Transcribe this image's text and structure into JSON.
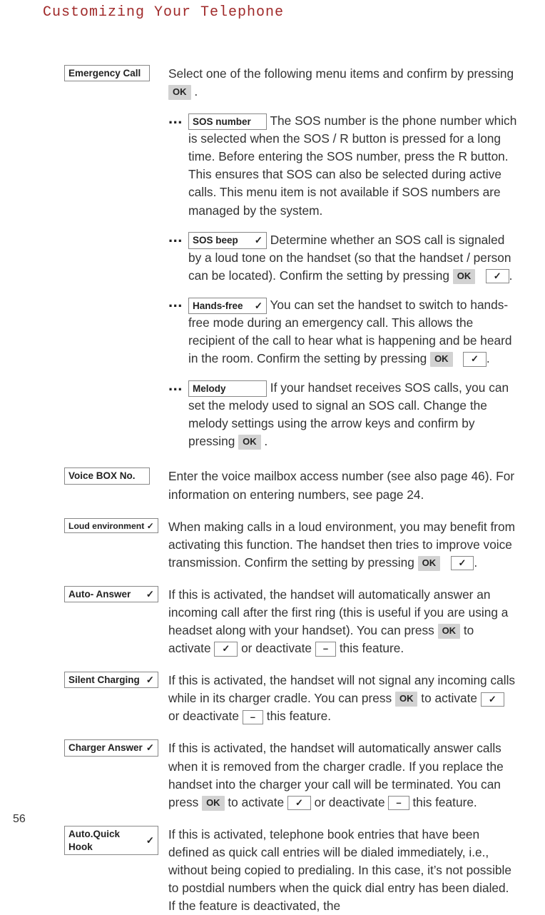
{
  "page_title": "Customizing Your Telephone",
  "page_number": "56",
  "keys": {
    "ok": "OK",
    "check": "✓",
    "minus": "–"
  },
  "ellipsis": "...",
  "sections": [
    {
      "id": "emergency",
      "label": "Emergency Call",
      "intro": "Select one of the following menu items and confirm by pressing ",
      "intro_suffix": " .",
      "subitems": [
        {
          "id": "sos_number",
          "label": "SOS number",
          "text": " The SOS number is the phone number which is selected when the SOS / R button is pressed for a long time. Before entering the SOS number, press the R button. This ensures that SOS can also be selected during active calls. This menu item is not available if SOS numbers are managed by the system."
        },
        {
          "id": "sos_beep",
          "label": "SOS beep",
          "label_check": true,
          "text_a": " Determine whether an SOS call is signaled by a loud tone on the handset (so that the handset / person can be located). Confirm the setting by pressing ",
          "text_b": "."
        },
        {
          "id": "hands_free",
          "label": "Hands-free",
          "label_check": true,
          "text_a": " You can set the handset to switch to hands-free mode during an emergency call. This allows the recipient of the call to hear what is happening and be heard in the room. Confirm the setting by pressing ",
          "text_b": "."
        },
        {
          "id": "melody",
          "label": "Melody",
          "text_a": " If your handset receives SOS calls, you can set the melody used to signal an SOS call. Change the melody settings using the arrow keys and confirm by pressing ",
          "text_b": " ."
        }
      ]
    },
    {
      "id": "voicebox",
      "label": "Voice BOX No.",
      "text": "Enter the voice mailbox access number (see also page 46). For information on entering numbers, see page 24."
    },
    {
      "id": "loud_env",
      "label": "Loud environment",
      "label_check": true,
      "text_a": "When making calls in a loud environment, you may benefit from activating this function. The handset then tries to improve voice transmission. Confirm the setting by pressing ",
      "text_b": "."
    },
    {
      "id": "auto_answer",
      "label": "Auto- Answer",
      "label_check": true,
      "text_a": "If this is activated, the handset will automatically answer an incoming call after the first ring (this is useful if you are using a headset along with your handset). You can press ",
      "text_b": " to activate ",
      "text_c": " or deactivate ",
      "text_d": " this feature."
    },
    {
      "id": "silent_charging",
      "label": "Silent Charging",
      "label_check": true,
      "text_a": "If this is activated, the handset will not signal any incoming calls while in its charger cradle. You can press ",
      "text_b": " to activate ",
      "text_c": " or deactivate ",
      "text_d": " this feature."
    },
    {
      "id": "charger_answer",
      "label": "Charger Answer",
      "label_check": true,
      "text_a": "If this is activated, the handset will automatically answer calls when it is removed from the charger cradle. If you replace the handset into the charger your call will be terminated. You can press ",
      "text_b": " to activate ",
      "text_c": " or deactivate ",
      "text_d": " this feature."
    },
    {
      "id": "auto_quick_hook",
      "label": "Auto.Quick Hook",
      "label_check": true,
      "text": "If this is activated, telephone book entries that have been defined as quick call entries will be dialed immediately, i.e., without being copied to predialing. In this case, it’s not possible to postdial numbers when the quick dial entry has been dialed. If the feature is deactivated, the"
    }
  ]
}
